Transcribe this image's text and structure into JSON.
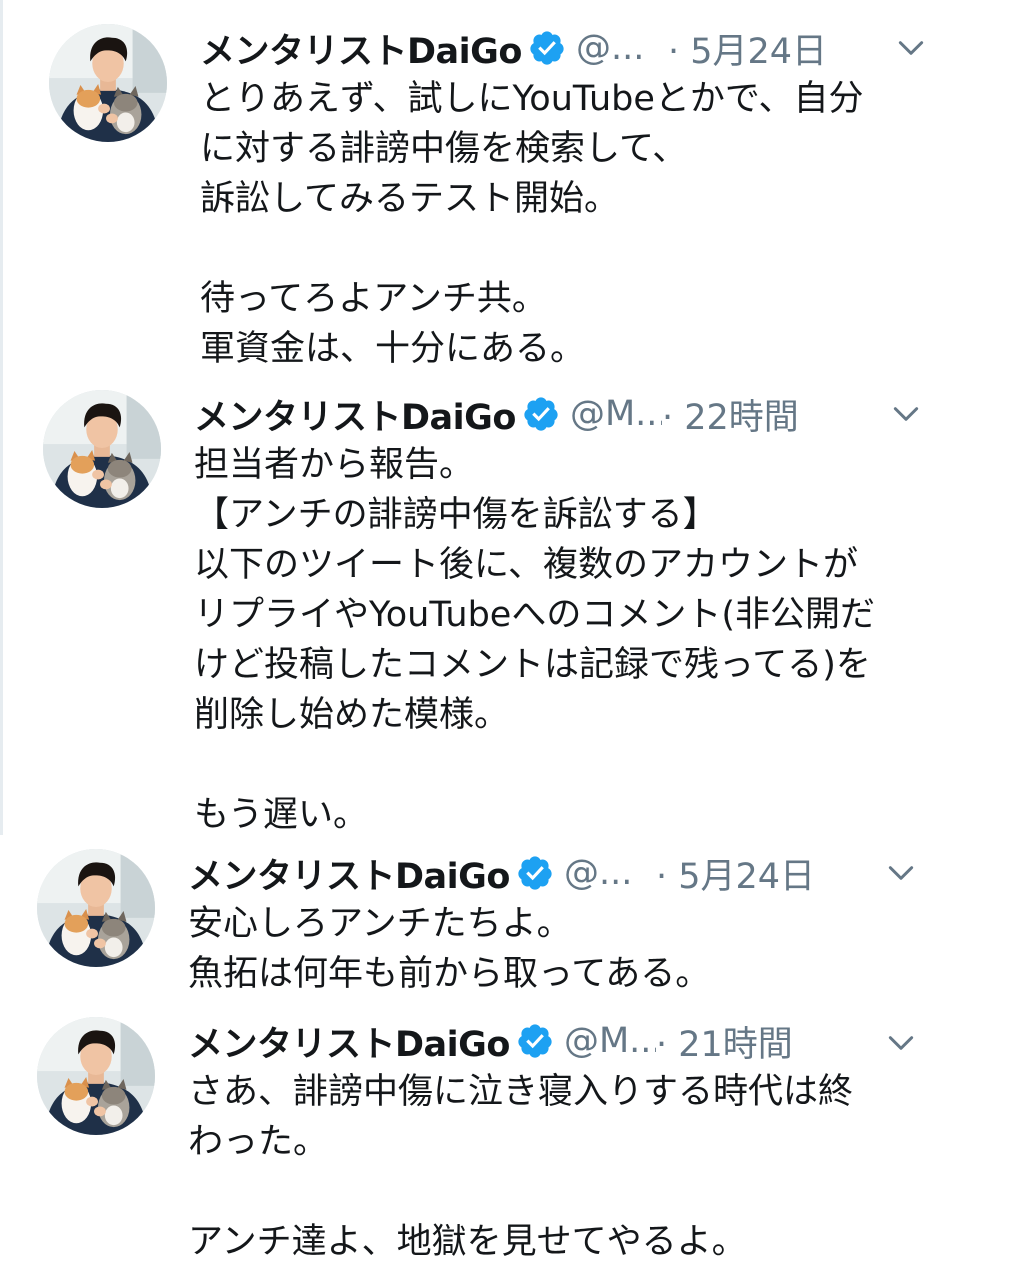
{
  "colors": {
    "text": "#14171a",
    "secondary": "#657786",
    "verified_badge": "#1da1f2",
    "background": "#ffffff"
  },
  "tweets": [
    {
      "display_name": "メンタリストDaiGo",
      "handle": "@...",
      "timestamp": "· 5月24日",
      "text": "とりあえず、試しにYouTubeとかで、自分\nに対する誹謗中傷を検索して、\n訴訟してみるテスト開始。\n\n待ってろよアンチ共。\n軍資金は、十分にある。",
      "avatar_icon": "user-photo-with-cats",
      "verified_icon": "verified-badge-icon",
      "menu_icon": "chevron-down-icon"
    },
    {
      "display_name": "メンタリストDaiGo",
      "handle": "@M...",
      "timestamp": "· 22時間",
      "text": "担当者から報告。\n【アンチの誹謗中傷を訴訟する】\n以下のツイート後に、複数のアカウントが\nリプライやYouTubeへのコメント(非公開だ\nけど投稿したコメントは記録で残ってる)を\n削除し始めた模様。\n\nもう遅い。",
      "avatar_icon": "user-photo-with-cats",
      "verified_icon": "verified-badge-icon",
      "menu_icon": "chevron-down-icon"
    },
    {
      "display_name": "メンタリストDaiGo",
      "handle": "@...",
      "timestamp": "· 5月24日",
      "text": "安心しろアンチたちよ。\n魚拓は何年も前から取ってある。",
      "avatar_icon": "user-photo-with-cats",
      "verified_icon": "verified-badge-icon",
      "menu_icon": "chevron-down-icon"
    },
    {
      "display_name": "メンタリストDaiGo",
      "handle": "@M...",
      "timestamp": "· 21時間",
      "text": "さあ、誹謗中傷に泣き寝入りする時代は終\nわった。\n\nアンチ達よ、地獄を見せてやるよ。",
      "avatar_icon": "user-photo-with-cats",
      "verified_icon": "verified-badge-icon",
      "menu_icon": "chevron-down-icon"
    }
  ]
}
